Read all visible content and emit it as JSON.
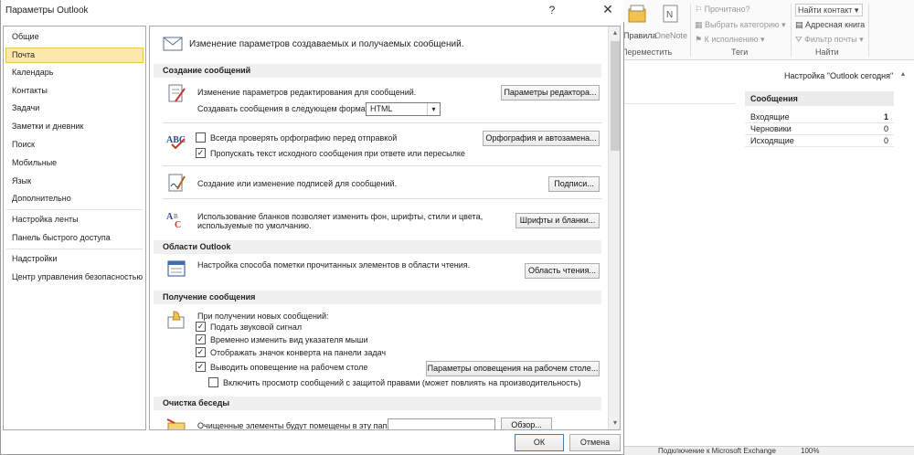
{
  "background": {
    "ribbon": {
      "move_btn_label": "Правила",
      "onenote_label": "OneNote",
      "move_group_label": "Переместить",
      "read_label": "Прочитано?",
      "category_label": "Выбрать категорию",
      "followup_label": "К исполнению",
      "tags_group_label": "Теги",
      "find_contact_label": "Найти контакт",
      "address_book_label": "Адресная книга",
      "filter_label": "Фильтр почты",
      "find_group_label": "Найти"
    },
    "today_label": "Настройка \"Outlook сегодня\"",
    "messages": {
      "header": "Сообщения",
      "rows": [
        {
          "name": "Входящие",
          "count": "1"
        },
        {
          "name": "Черновики",
          "count": "0"
        },
        {
          "name": "Исходящие",
          "count": "0"
        }
      ]
    },
    "status_bar": {
      "connection": "Подключение к Microsoft Exchange",
      "zoom": "100%"
    }
  },
  "dialog": {
    "title": "Параметры Outlook",
    "help_glyph": "?",
    "close_glyph": "✕",
    "sidebar": {
      "items": [
        "Общие",
        "Почта",
        "Календарь",
        "Контакты",
        "Задачи",
        "Заметки и дневник",
        "Поиск",
        "Мобильные",
        "Язык",
        "Дополнительно"
      ],
      "items2": [
        "Настройка ленты",
        "Панель быстрого доступа"
      ],
      "items3": [
        "Надстройки",
        "Центр управления безопасностью"
      ],
      "active": "Почта"
    },
    "content": {
      "header": "Изменение параметров создаваемых и получаемых сообщений.",
      "compose": {
        "section": "Создание сообщений",
        "editor_text": "Изменение параметров редактирования для сообщений.",
        "editor_btn": "Параметры редактора...",
        "format_label": "Создавать сообщения в следующем формате:",
        "format_value": "HTML",
        "spell_check_label": "Всегда проверять орфографию перед отправкой",
        "spell_check_checked": false,
        "ignore_original_label": "Пропускать текст исходного сообщения при ответе или пересылке",
        "ignore_original_checked": true,
        "spell_btn": "Орфография и автозамена...",
        "signatures_text": "Создание или изменение подписей для сообщений.",
        "signatures_btn": "Подписи...",
        "stationery_text_1": "Использование бланков позволяет изменить фон, шрифты, стили и цвета,",
        "stationery_text_2": "используемые по умолчанию.",
        "stationery_btn": "Шрифты и бланки..."
      },
      "panes": {
        "section": "Области Outlook",
        "reading_text": "Настройка способа пометки прочитанных элементов в области чтения.",
        "reading_btn": "Область чтения..."
      },
      "arrival": {
        "section": "Получение сообщения",
        "intro": "При получении новых сообщений:",
        "options": [
          {
            "label": "Подать звуковой сигнал",
            "checked": true
          },
          {
            "label": "Временно изменить вид указателя мыши",
            "checked": true
          },
          {
            "label": "Отображать значок конверта на панели задач",
            "checked": true
          },
          {
            "label": "Выводить оповещение на рабочем столе",
            "checked": true
          }
        ],
        "rights_label": "Включить просмотр сообщений с защитой правами (может повлиять на производительность)",
        "rights_checked": false,
        "alert_btn": "Параметры оповещения на рабочем столе..."
      },
      "cleanup": {
        "section": "Очистка беседы",
        "folder_text": "Очищенные элементы будут помещены в эту папку:",
        "browse_btn": "Обзор..."
      }
    },
    "ok_label": "ОК",
    "cancel_label": "Отмена"
  }
}
